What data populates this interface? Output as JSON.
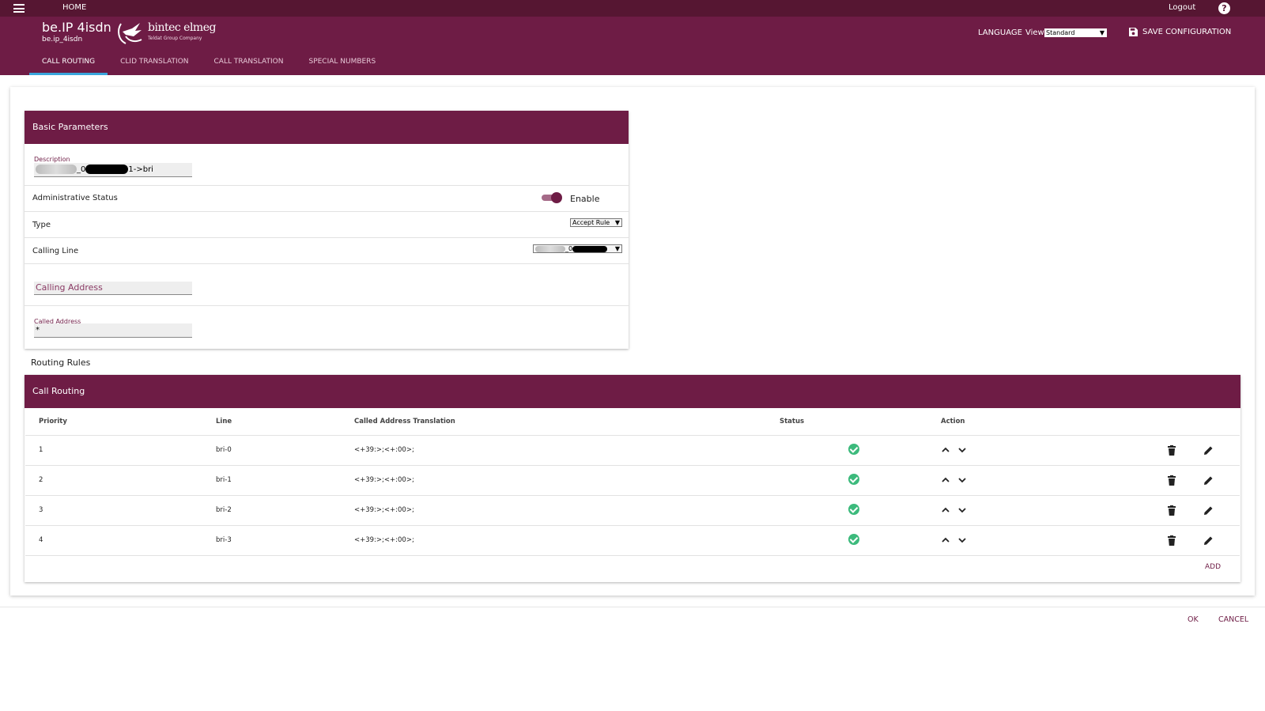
{
  "topbar": {
    "home_label": "HOME",
    "logout_label": "Logout",
    "help_symbol": "?"
  },
  "header": {
    "device_title": "be.IP 4isdn",
    "device_subtitle": "be.ip_4isdn",
    "logo_text": "bintec elmeg",
    "logo_subtext": "Teldat Group Company",
    "language_label": "LANGUAGE",
    "view_label": "View",
    "view_value": "Standard",
    "save_label": "SAVE CONFIGURATION",
    "tabs": [
      {
        "label": "CALL ROUTING",
        "active": true
      },
      {
        "label": "CLID TRANSLATION",
        "active": false
      },
      {
        "label": "CALL TRANSLATION",
        "active": false
      },
      {
        "label": "SPECIAL NUMBERS",
        "active": false
      }
    ]
  },
  "basic": {
    "title": "Basic Parameters",
    "description_label": "Description",
    "description_value_prefix": "_0",
    "description_value_suffix": "1->bri",
    "admin_status_label": "Administrative Status",
    "admin_status_value": "Enable",
    "admin_status_on": true,
    "type_label": "Type",
    "type_value": "Accept Rule",
    "calling_line_label": "Calling Line",
    "calling_line_value": "_0",
    "calling_address_placeholder": "Calling Address",
    "called_address_label": "Called Address",
    "called_address_value": "*"
  },
  "routing": {
    "section_title": "Routing Rules",
    "panel_title": "Call Routing",
    "columns": [
      "Priority",
      "Line",
      "Called Address Translation",
      "Status",
      "Action"
    ],
    "rows": [
      {
        "priority": "1",
        "line": "bri-0",
        "translation": "<+39:>;<+:00>;"
      },
      {
        "priority": "2",
        "line": "bri-1",
        "translation": "<+39:>;<+:00>;"
      },
      {
        "priority": "3",
        "line": "bri-2",
        "translation": "<+39:>;<+:00>;"
      },
      {
        "priority": "4",
        "line": "bri-3",
        "translation": "<+39:>;<+:00>;"
      }
    ],
    "add_label": "ADD"
  },
  "footer": {
    "ok_label": "OK",
    "cancel_label": "CANCEL"
  },
  "colors": {
    "brand": "#6e1c45",
    "topbar": "#561632",
    "status_ok": "#3cba7c",
    "tab_indicator": "#3aa5dc"
  }
}
